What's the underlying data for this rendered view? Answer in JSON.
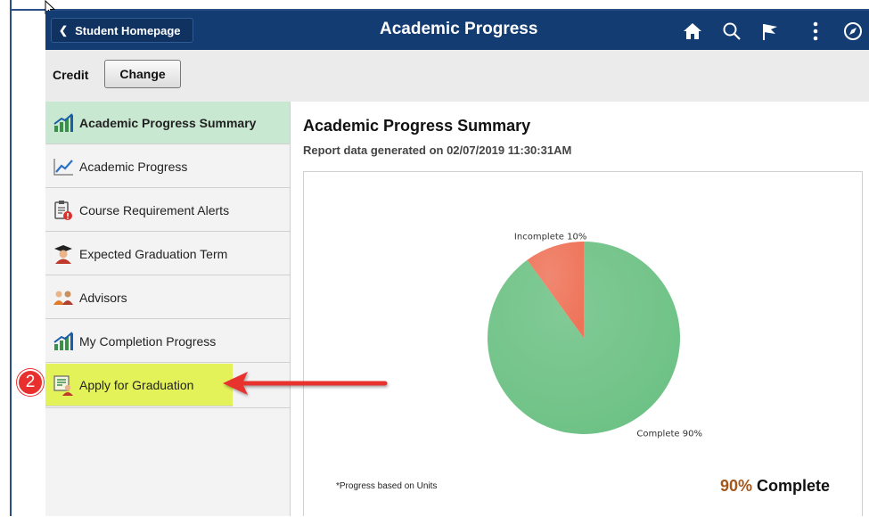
{
  "header": {
    "back_label": "Student Homepage",
    "title": "Academic Progress",
    "icons": [
      "home-icon",
      "search-icon",
      "flag-icon",
      "more-vertical-icon",
      "compass-icon"
    ]
  },
  "toolbar": {
    "career_label": "Credit",
    "change_label": "Change"
  },
  "sidebar": {
    "items": [
      {
        "label": "Academic Progress Summary",
        "icon": "progress-chart-icon",
        "state": "selected"
      },
      {
        "label": "Academic Progress",
        "icon": "line-chart-icon"
      },
      {
        "label": "Course Requirement Alerts",
        "icon": "alert-clipboard-icon"
      },
      {
        "label": "Expected Graduation Term",
        "icon": "graduate-icon"
      },
      {
        "label": "Advisors",
        "icon": "advisors-icon"
      },
      {
        "label": "My Completion Progress",
        "icon": "progress-chart-icon"
      },
      {
        "label": "Apply for Graduation",
        "icon": "apply-graduation-icon",
        "state": "highlighted"
      }
    ]
  },
  "main": {
    "title": "Academic Progress Summary",
    "subtitle": "Report data generated on 02/07/2019 11:30:31AM",
    "footnote": "*Progress based on Units",
    "complete_pct": "90%",
    "complete_word": "Complete"
  },
  "annotation": {
    "step_number": "2",
    "color": "#e8312f"
  },
  "colors": {
    "header_bg": "#133c73",
    "selected_bg": "#c9e8d2",
    "highlight_bg": "#e4f25a",
    "complete_slice": "#6cc184",
    "incomplete_slice": "#ee7358"
  },
  "chart_data": {
    "type": "pie",
    "slices": [
      {
        "label": "Complete 90%",
        "value": 90,
        "color": "#6cc184"
      },
      {
        "label": "Incomplete 10%",
        "value": 10,
        "color": "#ee7358"
      }
    ]
  }
}
